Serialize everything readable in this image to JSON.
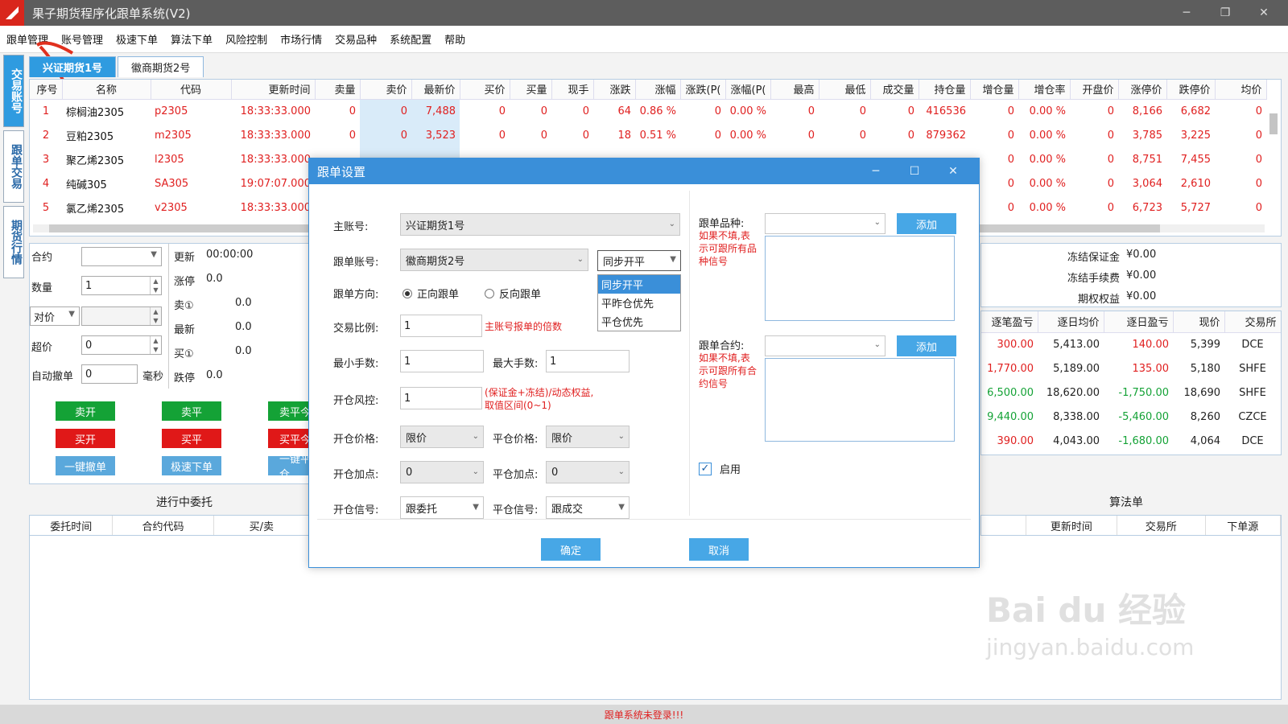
{
  "app": {
    "title": "果子期货程序化跟单系统(V2)"
  },
  "menu": [
    "跟单管理",
    "账号管理",
    "极速下单",
    "算法下单",
    "风险控制",
    "市场行情",
    "交易品种",
    "系统配置",
    "帮助"
  ],
  "side_tabs": [
    "交易账号",
    "跟单交易",
    "期货行情"
  ],
  "account_tabs": [
    "兴证期货1号",
    "徽商期货2号"
  ],
  "market_table": {
    "headers": [
      "序号",
      "名称",
      "代码",
      "更新时间",
      "卖量",
      "卖价",
      "最新价",
      "买价",
      "买量",
      "现手",
      "涨跌",
      "涨幅",
      "涨跌(P(",
      "涨幅(P(",
      "最高",
      "最低",
      "成交量",
      "持仓量",
      "增仓量",
      "增仓率",
      "开盘价",
      "涨停价",
      "跌停价",
      "均价"
    ],
    "rows": [
      [
        "1",
        "棕榈油2305",
        "p2305",
        "18:33:33.000",
        "0",
        "0",
        "7,488",
        "0",
        "0",
        "0",
        "64",
        "0.86 %",
        "0",
        "0.00 %",
        "0",
        "0",
        "0",
        "416536",
        "0",
        "0.00 %",
        "0",
        "8,166",
        "6,682",
        "0"
      ],
      [
        "2",
        "豆粕2305",
        "m2305",
        "18:33:33.000",
        "0",
        "0",
        "3,523",
        "0",
        "0",
        "0",
        "18",
        "0.51 %",
        "0",
        "0.00 %",
        "0",
        "0",
        "0",
        "879362",
        "0",
        "0.00 %",
        "0",
        "3,785",
        "3,225",
        "0"
      ],
      [
        "3",
        "聚乙烯2305",
        "l2305",
        "18:33:33.000",
        "",
        "",
        "",
        "",
        "",
        "",
        "",
        "",
        "",
        "",
        "",
        "",
        "",
        "",
        "0",
        "0.00 %",
        "0",
        "8,751",
        "7,455",
        "0"
      ],
      [
        "4",
        "纯碱305",
        "SA305",
        "19:07:07.000",
        "",
        "",
        "",
        "",
        "",
        "",
        "",
        "",
        "",
        "",
        "",
        "",
        "",
        "",
        "0",
        "0.00 %",
        "0",
        "3,064",
        "2,610",
        "0"
      ],
      [
        "5",
        "氯乙烯2305",
        "v2305",
        "18:33:33.000",
        "",
        "",
        "",
        "",
        "",
        "",
        "",
        "",
        "",
        "",
        "",
        "",
        "",
        "",
        "0",
        "0.00 %",
        "0",
        "6,723",
        "5,727",
        "0"
      ]
    ]
  },
  "order_panel": {
    "contract_label": "合约",
    "qty_label": "数量",
    "qty_value": "1",
    "price_type": "对价",
    "overprice_label": "超价",
    "overprice_value": "0",
    "auto_cancel_label": "自动撤单",
    "auto_cancel_value": "0",
    "auto_cancel_unit": "毫秒",
    "quote": [
      {
        "k": "更新",
        "v": "00:00:00"
      },
      {
        "k": "涨停",
        "v": "0.0"
      },
      {
        "k": "卖①",
        "v": "0.0"
      },
      {
        "k": "最新",
        "v": "0.0"
      },
      {
        "k": "买①",
        "v": "0.0"
      },
      {
        "k": "跌停",
        "v": "0.0"
      }
    ],
    "buttons": {
      "sell_open": "卖开",
      "sell_close": "卖平",
      "sell_close_today": "卖平今",
      "buy_open": "买开",
      "buy_close": "买平",
      "buy_close_today": "买平今",
      "cancel_all": "一键撤单",
      "fast_order": "极速下单",
      "close_all": "一键平仓"
    }
  },
  "account_info": [
    {
      "k": "冻结保证金",
      "v": "¥0.00"
    },
    {
      "k": "冻结手续费",
      "v": "¥0.00"
    },
    {
      "k": "期权权益",
      "v": "¥0.00"
    }
  ],
  "positions": {
    "headers": [
      "逐笔盈亏",
      "逐日均价",
      "逐日盈亏",
      "现价",
      "交易所"
    ],
    "rows": [
      {
        "c1": "300.00",
        "c2": "5,413.00",
        "c3": "140.00",
        "c4": "5,399",
        "c5": "DCE",
        "c1color": "#e02020",
        "c3color": "#e02020"
      },
      {
        "c1": "1,770.00",
        "c2": "5,189.00",
        "c3": "135.00",
        "c4": "5,180",
        "c5": "SHFE",
        "c1color": "#e02020",
        "c3color": "#e02020"
      },
      {
        "c1": "6,500.00",
        "c2": "18,620.00",
        "c3": "-1,750.00",
        "c4": "18,690",
        "c5": "SHFE",
        "c1color": "#14a236",
        "c3color": "#14a236"
      },
      {
        "c1": "9,440.00",
        "c2": "8,338.00",
        "c3": "-5,460.00",
        "c4": "8,260",
        "c5": "CZCE",
        "c1color": "#14a236",
        "c3color": "#14a236"
      },
      {
        "c1": "390.00",
        "c2": "4,043.00",
        "c3": "-1,680.00",
        "c4": "4,064",
        "c5": "DCE",
        "c1color": "#e02020",
        "c3color": "#14a236"
      }
    ]
  },
  "entrusts": {
    "title": "进行中委托",
    "headers": [
      "委托时间",
      "合约代码",
      "买/卖"
    ]
  },
  "algo": {
    "title": "算法单",
    "headers": [
      "更新时间",
      "交易所",
      "下单源"
    ]
  },
  "status": "跟单系统未登录!!!",
  "watermark": {
    "main": "Bai du 经验",
    "sub": "jingyan.baidu.com"
  },
  "dialog": {
    "title": "跟单设置",
    "master_label": "主账号:",
    "master_value": "兴证期货1号",
    "follow_label": "跟单账号:",
    "follow_value": "徽商期货2号",
    "mode_value": "同步开平",
    "mode_options": [
      "同步开平",
      "平昨仓优先",
      "平仓优先"
    ],
    "direction_label": "跟单方向:",
    "dir_forward": "正向跟单",
    "dir_reverse": "反向跟单",
    "ratio_label": "交易比例:",
    "ratio_value": "1",
    "ratio_hint": "主账号报单的倍数",
    "min_label": "最小手数:",
    "min_value": "1",
    "max_label": "最大手数:",
    "max_value": "1",
    "risk_label": "开仓风控:",
    "risk_value": "1",
    "risk_hint1": "(保证金+冻结)/动态权益,",
    "risk_hint2": "取值区间(0~1)",
    "open_price_label": "开仓价格:",
    "open_price_value": "限价",
    "close_price_label": "平仓价格:",
    "close_price_value": "限价",
    "open_add_label": "开仓加点:",
    "open_add_value": "0",
    "close_add_label": "平仓加点:",
    "close_add_value": "0",
    "open_signal_label": "开仓信号:",
    "open_signal_value": "跟委托",
    "close_signal_label": "平仓信号:",
    "close_signal_value": "跟成交",
    "variety_label": "跟单品种:",
    "variety_hint": [
      "如果不填,表",
      "示可跟所有品",
      "种信号"
    ],
    "contract_label": "跟单合约:",
    "contract_hint": [
      "如果不填,表",
      "示可跟所有合",
      "约信号"
    ],
    "add": "添加",
    "enable": "启用",
    "ok": "确定",
    "cancel": "取消"
  }
}
